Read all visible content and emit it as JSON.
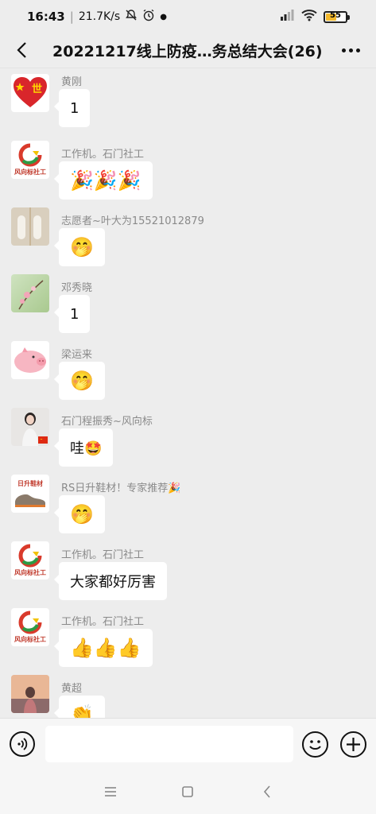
{
  "status_bar": {
    "time": "16:43",
    "speed": "21.7K/s",
    "battery": "55",
    "battery_level": 0.55
  },
  "header": {
    "title": "20221217线上防疫…务总结大会(26)"
  },
  "messages": [
    {
      "sender": "黄刚",
      "content": "1",
      "avatar_icon": "heart-avatar"
    },
    {
      "sender": "工作机。石门社工",
      "content": "🎉🎉🎉",
      "avatar_icon": "fengxiangbiao-logo-avatar",
      "avatar_caption": "风向标社工"
    },
    {
      "sender": "志愿者~叶大为15521012879",
      "content": "🤭",
      "avatar_icon": "shoes-photo-avatar"
    },
    {
      "sender": "邓秀晓",
      "content": "1",
      "avatar_icon": "flower-photo-avatar"
    },
    {
      "sender": "梁运来",
      "content": "🤭",
      "avatar_icon": "pig-avatar"
    },
    {
      "sender": "石门程振秀~风向标",
      "content": "哇🤩",
      "avatar_icon": "girl-photo-avatar"
    },
    {
      "sender": "RS日升鞋材！专家推荐🎉",
      "content": "🤭",
      "avatar_icon": "shoe-product-avatar",
      "avatar_caption": "日升鞋材"
    },
    {
      "sender": "工作机。石门社工",
      "content": "大家都好厉害",
      "avatar_icon": "fengxiangbiao-logo-avatar",
      "avatar_caption": "风向标社工"
    },
    {
      "sender": "工作机。石门社工",
      "content": "👍👍👍",
      "avatar_icon": "fengxiangbiao-logo-avatar",
      "avatar_caption": "风向标社工"
    },
    {
      "sender": "黄超",
      "content": "👏",
      "avatar_icon": "sky-photo-avatar"
    }
  ],
  "input": {
    "value": "",
    "placeholder": ""
  },
  "colors": {
    "background": "#ededed",
    "bubble": "#ffffff",
    "sender_text": "#8a8a8a",
    "battery_fill": "#f3b82b",
    "logo_red": "#d93a2b",
    "logo_green": "#2e9b45",
    "logo_yellow": "#f2c200"
  }
}
